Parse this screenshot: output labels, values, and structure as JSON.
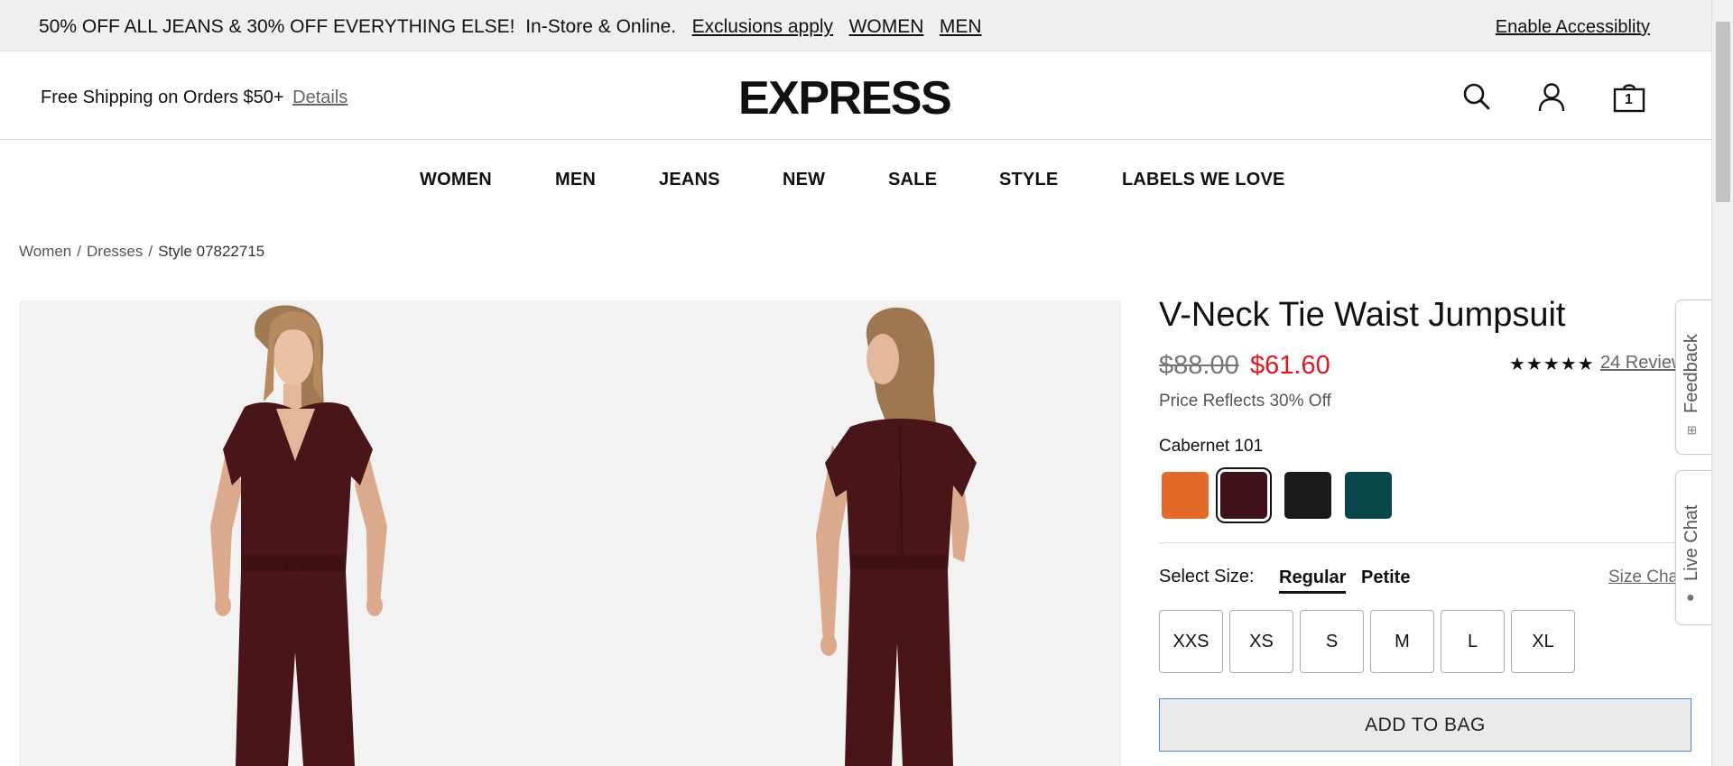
{
  "promo": {
    "message": "50% OFF ALL JEANS & 30% OFF EVERYTHING ELSE!",
    "channel": "In-Store & Online.",
    "exclusions": "Exclusions apply",
    "women": "WOMEN",
    "men": "MEN",
    "accessibility": "Enable Accessiblity"
  },
  "header": {
    "shipping_text": "Free Shipping on Orders $50+",
    "details_link": "Details",
    "logo": "EXPRESS",
    "icons": [
      "search-icon",
      "account-icon",
      "bag-icon"
    ],
    "bag_count": "1"
  },
  "nav": [
    "WOMEN",
    "MEN",
    "JEANS",
    "NEW",
    "SALE",
    "STYLE",
    "LABELS WE LOVE"
  ],
  "breadcrumb": [
    "Women",
    "Dresses",
    "Style 07822715"
  ],
  "product": {
    "title": "V-Neck Tie Waist Jumpsuit",
    "original_price": "$88.00",
    "sale_price": "$61.60",
    "stars": "★★★★★",
    "reviews": "24 Reviews",
    "price_note": "Price Reflects 30% Off",
    "selected_color": "Cabernet 101",
    "swatches": [
      {
        "color": "#e46a2a"
      },
      {
        "color": "#3e1218"
      },
      {
        "color": "#1a1a18"
      },
      {
        "color": "#07474a"
      }
    ],
    "size_label": "Select Size:",
    "fits": [
      "Regular",
      "Petite"
    ],
    "size_chart": "Size Chart",
    "sizes": [
      "XXS",
      "XS",
      "S",
      "M",
      "L",
      "XL"
    ],
    "add_to_bag": "ADD TO BAG"
  },
  "side_tabs": {
    "feedback": "Feedback",
    "live_chat": "Live Chat"
  },
  "colors": {
    "sale_red": "#e3161f",
    "garment": "#4a1519",
    "promo_bg": "#eeefef"
  }
}
